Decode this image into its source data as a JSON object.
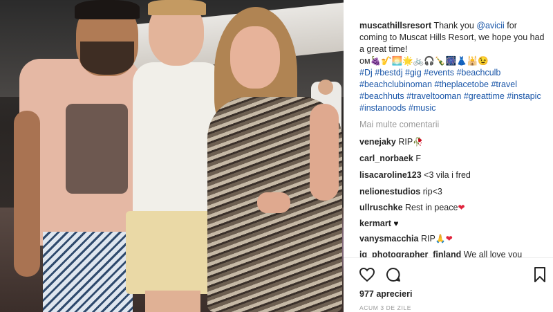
{
  "post": {
    "username": "muscathillsresort",
    "caption_pre": " Thank you ",
    "mention": "@avicii",
    "caption_post": " for coming to Muscat Hills Resort, we hope you had a great time!",
    "emoji_line": "ом🍇🎷🌅🌟🚲🎧🍾🎆👗🕌😉",
    "hashtags": [
      "#Dj",
      "#bestdj",
      "#gig",
      "#events",
      "#beachculb",
      "#beachclubinoman",
      "#theplacetobe",
      "#travel",
      "#beachhuts",
      "#traveltooman",
      "#greattime",
      "#instapic",
      "#instanoods",
      "#music"
    ]
  },
  "more_comments_label": "Mai multe comentarii",
  "comments": [
    {
      "user": "venejaky",
      "text": "RIP",
      "emoji": "🥀"
    },
    {
      "user": "carl_norbaek",
      "text": "F",
      "emoji": ""
    },
    {
      "user": "lisacaroline123",
      "text": "<3 vila i fred",
      "emoji": ""
    },
    {
      "user": "nelionestudios",
      "text": "rip<3",
      "emoji": ""
    },
    {
      "user": "ullruschke",
      "text": "Rest in peace",
      "emoji": "❤"
    },
    {
      "user": "kermart",
      "text": "",
      "emoji": "♥"
    },
    {
      "user": "vanysmacchia",
      "text": "RIP",
      "emoji": "🙏❤"
    },
    {
      "user": "ig_photographer_finland",
      "text": "We all love you",
      "emoji": ""
    }
  ],
  "actions": {
    "like_icon": "heart-outline-icon",
    "comment_icon": "speech-bubble-icon",
    "save_icon": "bookmark-icon"
  },
  "likes_label": "977 aprecieri",
  "timestamp": "ACUM 3 DE ZILE",
  "colors": {
    "link": "#1a56a8",
    "muted": "#999999",
    "heart": "#e0243d"
  }
}
